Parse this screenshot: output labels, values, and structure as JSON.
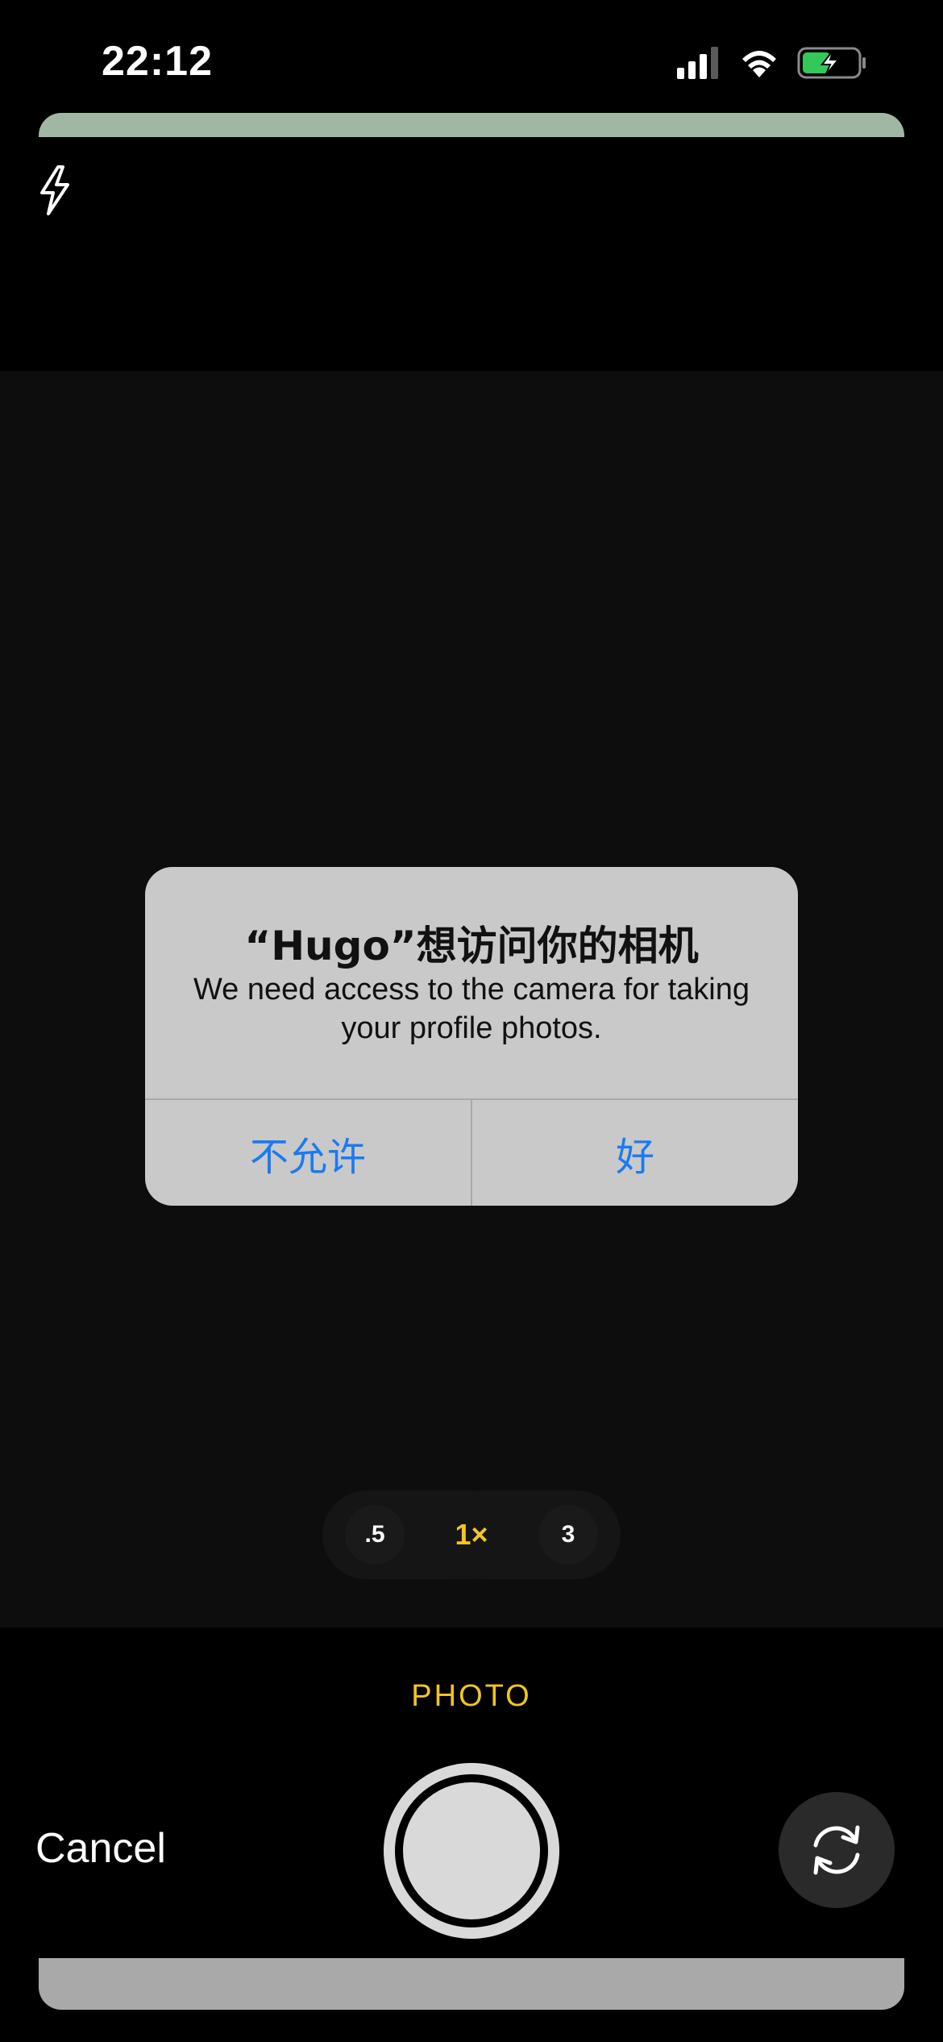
{
  "status_bar": {
    "time": "22:12",
    "icons": [
      "cellular-signal-icon",
      "wifi-icon",
      "battery-charging-icon"
    ],
    "battery_color": "#34c759"
  },
  "camera": {
    "flash_icon": "flash-icon",
    "zoom_options": [
      ".5",
      "1×",
      "3"
    ],
    "zoom_selected": "1×",
    "mode": "PHOTO",
    "cancel_label": "Cancel",
    "flip_icon": "camera-flip-icon",
    "accent_color": "#f2c521"
  },
  "alert": {
    "title": "“Hugo”想访问你的相机",
    "message": "We need access to the camera for taking your profile photos.",
    "deny_label": "不允许",
    "allow_label": "好",
    "button_color": "#1a7bf0"
  }
}
